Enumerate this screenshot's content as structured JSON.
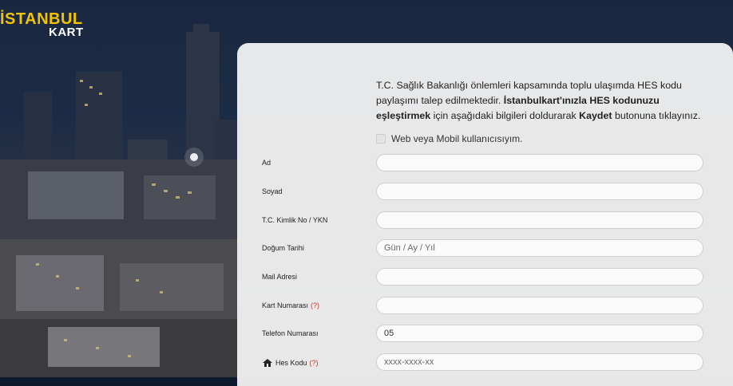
{
  "logo": {
    "line1": "İSTANBUL",
    "line2": "KART"
  },
  "intro": {
    "part1": "T.C. Sağlık Bakanlığı önlemleri kapsamında toplu ulaşımda HES kodu paylaşımı talep edilmektedir. ",
    "bold1": "İstanbulkart'ınızla HES kodunuzu eşleştirmek",
    "part2": " için aşağıdaki bilgileri doldurarak ",
    "bold2": "Kaydet",
    "part3": " butonuna tıklayınız."
  },
  "web_mobile_checkbox": {
    "label": "Web veya Mobil kullanıcısıyım.",
    "checked": false
  },
  "form": {
    "ad": {
      "label": "Ad",
      "value": "",
      "placeholder": ""
    },
    "soyad": {
      "label": "Soyad",
      "value": "",
      "placeholder": ""
    },
    "tc": {
      "label": "T.C. Kimlik No / YKN",
      "value": "",
      "placeholder": ""
    },
    "dogum": {
      "label": "Doğum Tarihi",
      "value": "",
      "placeholder": "Gün / Ay / Yıl"
    },
    "mail": {
      "label": "Mail Adresi",
      "value": "",
      "placeholder": ""
    },
    "kart": {
      "label": "Kart Numarası",
      "help": "(?)",
      "value": "",
      "placeholder": ""
    },
    "telefon": {
      "label": "Telefon Numarası",
      "value": "05",
      "placeholder": ""
    },
    "hes": {
      "label": "Hes Kodu",
      "help": "(?)",
      "value": "",
      "placeholder": "xxxx-xxxx-xx"
    }
  },
  "colors": {
    "logo_yellow": "#f2c400",
    "help_red": "#c0392b",
    "panel_bg": "#eeeeee"
  }
}
